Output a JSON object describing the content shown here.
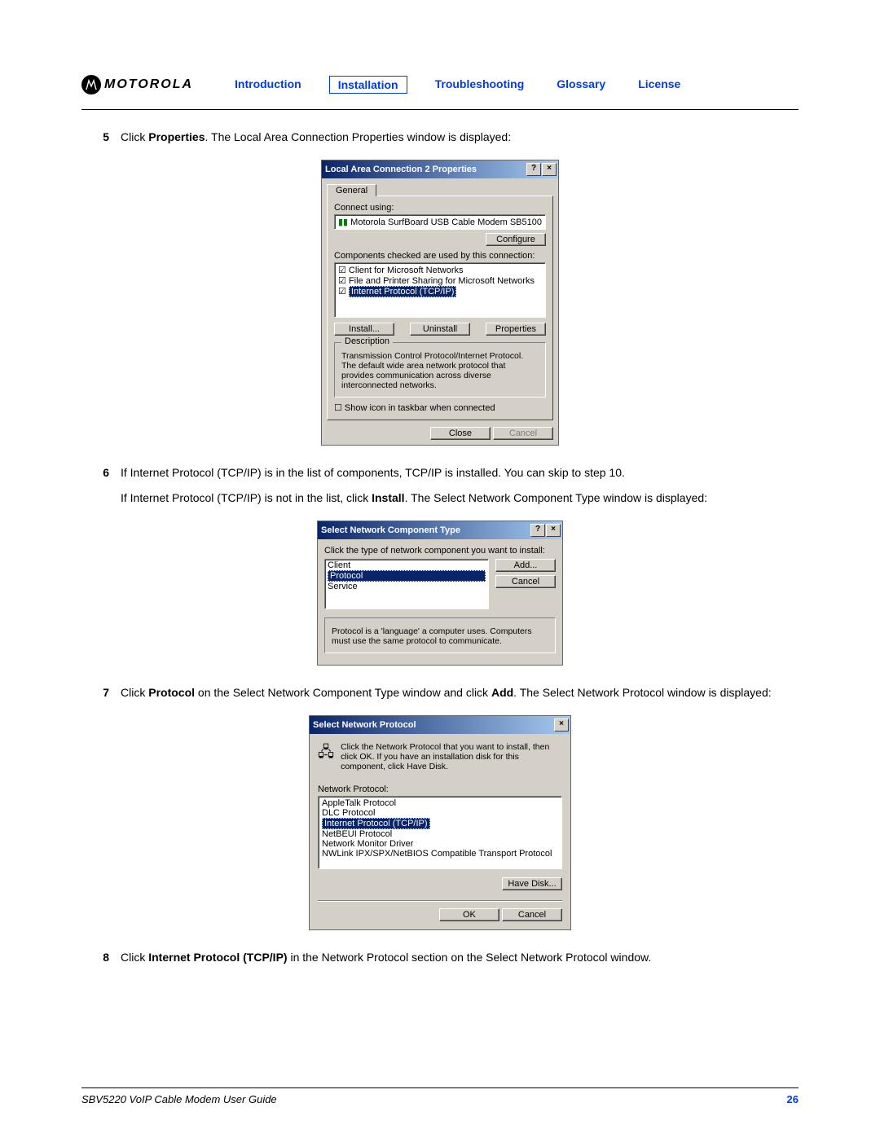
{
  "header": {
    "logo": "MOTOROLA",
    "nav": {
      "intro": "Introduction",
      "install": "Installation",
      "trouble": "Troubleshooting",
      "gloss": "Glossary",
      "lic": "License"
    }
  },
  "steps": {
    "s5": {
      "num": "5",
      "p1a": "Click ",
      "p1b": "Properties",
      "p1c": ". The Local Area Connection Properties window is displayed:"
    },
    "mock1": {
      "title": "Local Area Connection 2 Properties",
      "tab": "General",
      "connectUsing": "Connect using:",
      "device": "Motorola SurfBoard USB Cable Modem SB5100",
      "configure": "Configure",
      "compLabel": "Components checked are used by this connection:",
      "c1": "Client for Microsoft Networks",
      "c2": "File and Printer Sharing for Microsoft Networks",
      "c3": "Internet Protocol (TCP/IP)",
      "install": "Install...",
      "uninstall": "Uninstall",
      "properties": "Properties",
      "descLabel": "Description",
      "desc": "Transmission Control Protocol/Internet Protocol. The default wide area network protocol that provides communication across diverse interconnected networks.",
      "showIcon": "Show icon in taskbar when connected",
      "close": "Close",
      "cancel": "Cancel"
    },
    "s6": {
      "num": "6",
      "p1": "If Internet Protocol (TCP/IP) is in the list of components, TCP/IP is installed. You can skip to step 10.",
      "p2a": "If Internet Protocol (TCP/IP) is not in the list, click ",
      "p2b": "Install",
      "p2c": ". The Select Network Component Type window is displayed:"
    },
    "mock2": {
      "title": "Select Network Component Type",
      "label": "Click the type of network component you want to install:",
      "i1": "Client",
      "i2": "Protocol",
      "i3": "Service",
      "add": "Add...",
      "cancel": "Cancel",
      "note": "Protocol is a 'language' a computer uses. Computers must use the same protocol to communicate."
    },
    "s7": {
      "num": "7",
      "t1": "Click ",
      "tb": "Protocol",
      "t2": " on the Select Network Component Type window and click ",
      "tb2": "Add",
      "t3": ". The Select Network Protocol window is displayed:"
    },
    "mock3": {
      "title": "Select Network Protocol",
      "instr": "Click the Network Protocol that you want to install, then click OK. If you have an installation disk for this component, click Have Disk.",
      "listLabel": "Network Protocol:",
      "p1": "AppleTalk Protocol",
      "p2": "DLC Protocol",
      "p3": "Internet Protocol (TCP/IP)",
      "p4": "NetBEUI Protocol",
      "p5": "Network Monitor Driver",
      "p6": "NWLink IPX/SPX/NetBIOS Compatible Transport Protocol",
      "havedisk": "Have Disk...",
      "ok": "OK",
      "cancel": "Cancel"
    },
    "s8": {
      "num": "8",
      "t1": "Click ",
      "tb": "Internet Protocol (TCP/IP)",
      "t2": " in the Network Protocol section on the Select Network Protocol window."
    }
  },
  "footer": {
    "guide": "SBV5220 VoIP Cable Modem User Guide",
    "page": "26"
  }
}
